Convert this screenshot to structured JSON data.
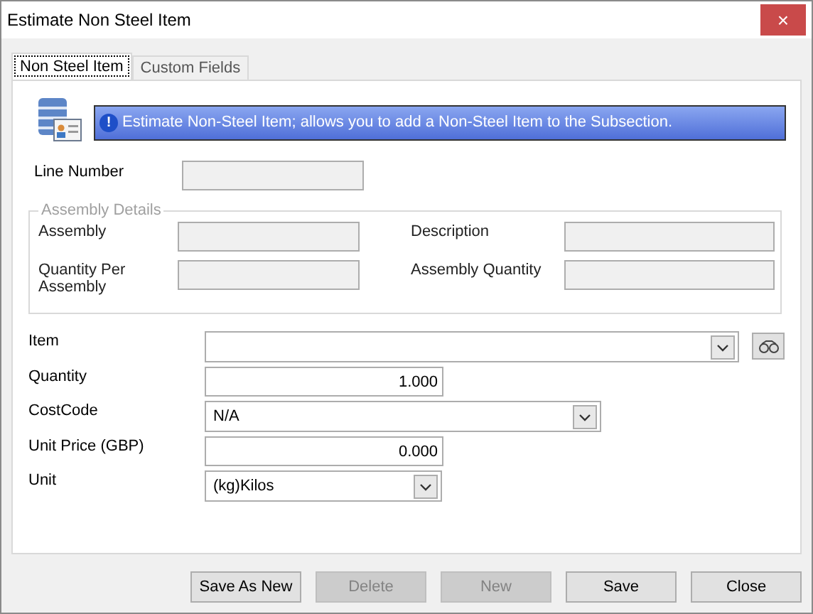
{
  "window": {
    "title": "Estimate Non Steel Item",
    "close": "×"
  },
  "tabs": [
    {
      "label": "Non Steel Item",
      "selected": true
    },
    {
      "label": "Custom Fields",
      "selected": false
    }
  ],
  "banner": {
    "icon": "!",
    "text": "Estimate Non-Steel Item; allows you to add a Non-Steel Item to the Subsection."
  },
  "line_number": {
    "label": "Line Number",
    "disabled": true
  },
  "assembly_details": {
    "title": "Assembly Details",
    "fields": [
      {
        "label": "Assembly",
        "disabled": true
      },
      {
        "label": "Description",
        "disabled": true
      },
      {
        "label": "Quantity Per Assembly",
        "disabled": true
      },
      {
        "label": "Assembly Quantity",
        "disabled": true
      }
    ]
  },
  "form": [
    {
      "label": "Item",
      "kind": "combo",
      "lookup": true
    },
    {
      "label": "Quantity",
      "kind": "number",
      "value": "1.000",
      "lookup": false
    },
    {
      "label": "CostCode",
      "kind": "combo",
      "value": "N/A",
      "lookup": false
    },
    {
      "label": "Unit Price (GBP)",
      "kind": "number",
      "value": "0.000",
      "lookup": false
    },
    {
      "label": "Unit",
      "kind": "combo",
      "value": "(kg)Kilos",
      "lookup": false
    }
  ],
  "buttons": [
    {
      "label": "Save As New",
      "disabled": false
    },
    {
      "label": "Delete",
      "disabled": true
    },
    {
      "label": "New",
      "disabled": true
    },
    {
      "label": "Save",
      "disabled": false
    },
    {
      "label": "Close",
      "disabled": false
    }
  ]
}
